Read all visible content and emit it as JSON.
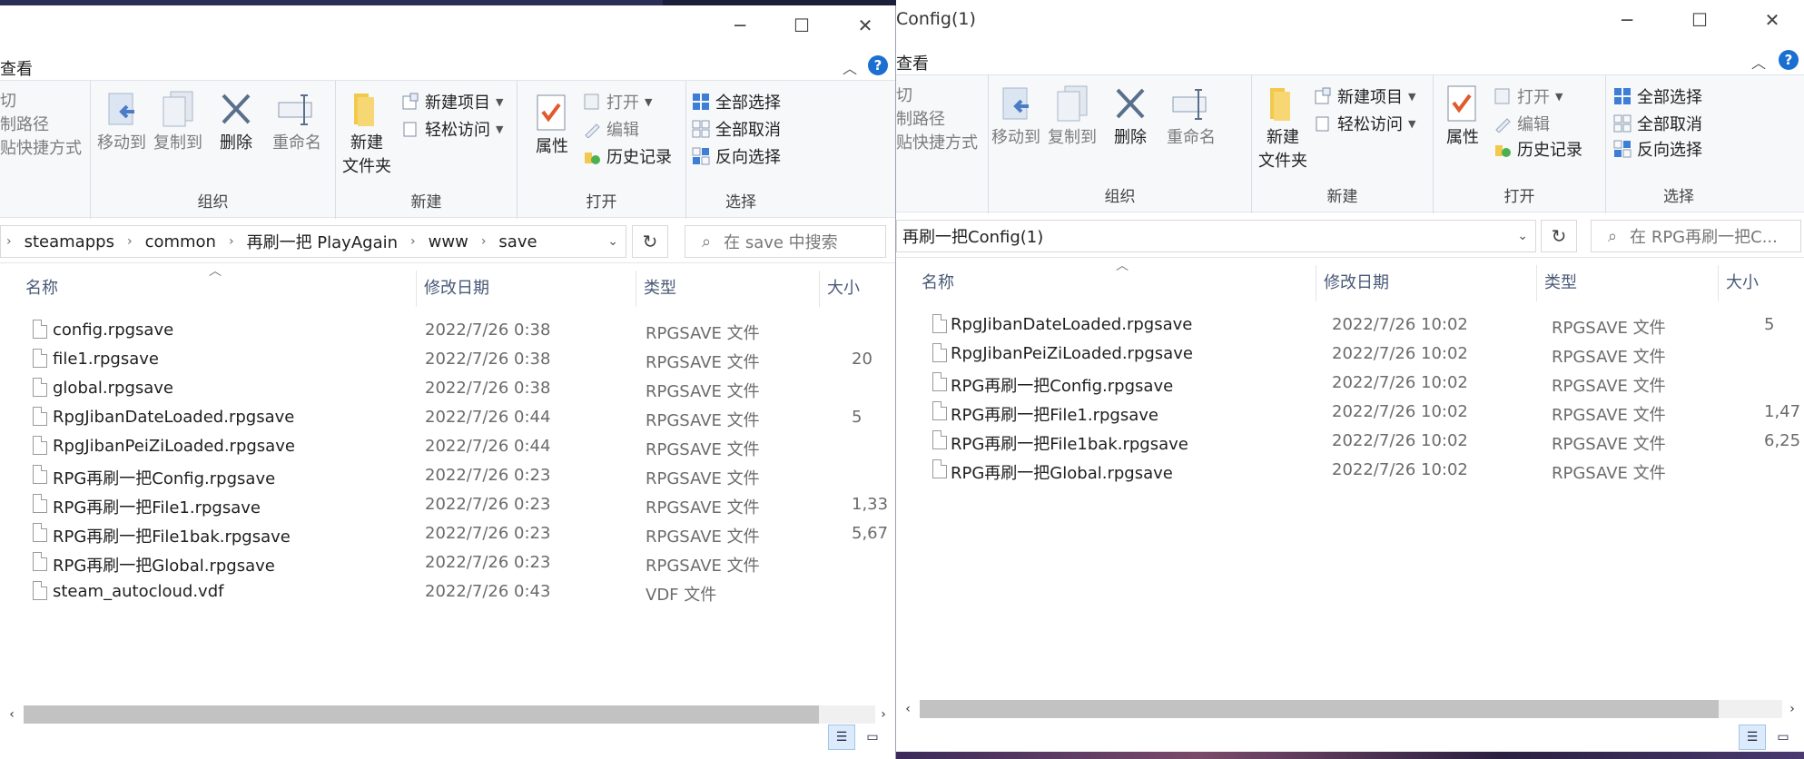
{
  "left": {
    "tab_label": "查看",
    "window_controls": {
      "minimize": "─",
      "maximize": "☐",
      "close": "✕"
    },
    "help_label": "?",
    "ribbon": {
      "clipboard_partial": [
        "切",
        "制路径",
        "贴快捷方式"
      ],
      "organize": {
        "move_to": "移动到",
        "copy_to": "复制到",
        "delete": "删除",
        "rename": "重命名",
        "group": "组织"
      },
      "new": {
        "new_folder_line1": "新建",
        "new_folder_line2": "文件夹",
        "new_item": "新建项目",
        "easy_access": "轻松访问",
        "group": "新建"
      },
      "open": {
        "properties": "属性",
        "open": "打开",
        "edit": "编辑",
        "history": "历史记录",
        "group": "打开"
      },
      "select": {
        "select_all": "全部选择",
        "select_none": "全部取消",
        "invert": "反向选择",
        "group": "选择"
      }
    },
    "address": {
      "crumbs": [
        "steamapps",
        "common",
        "再刷一把 PlayAgain",
        "www",
        "save"
      ]
    },
    "search_placeholder": "在 save 中搜索",
    "columns": {
      "name": "名称",
      "date": "修改日期",
      "type": "类型",
      "size": "大小"
    },
    "files": [
      {
        "name": "config.rpgsave",
        "date": "2022/7/26 0:38",
        "type": "RPGSAVE 文件",
        "size": ""
      },
      {
        "name": "file1.rpgsave",
        "date": "2022/7/26 0:38",
        "type": "RPGSAVE 文件",
        "size": "20"
      },
      {
        "name": "global.rpgsave",
        "date": "2022/7/26 0:38",
        "type": "RPGSAVE 文件",
        "size": ""
      },
      {
        "name": "RpgJibanDateLoaded.rpgsave",
        "date": "2022/7/26 0:44",
        "type": "RPGSAVE 文件",
        "size": "5"
      },
      {
        "name": "RpgJibanPeiZiLoaded.rpgsave",
        "date": "2022/7/26 0:44",
        "type": "RPGSAVE 文件",
        "size": ""
      },
      {
        "name": "RPG再刷一把Config.rpgsave",
        "date": "2022/7/26 0:23",
        "type": "RPGSAVE 文件",
        "size": ""
      },
      {
        "name": "RPG再刷一把File1.rpgsave",
        "date": "2022/7/26 0:23",
        "type": "RPGSAVE 文件",
        "size": "1,33"
      },
      {
        "name": "RPG再刷一把File1bak.rpgsave",
        "date": "2022/7/26 0:23",
        "type": "RPGSAVE 文件",
        "size": "5,67"
      },
      {
        "name": "RPG再刷一把Global.rpgsave",
        "date": "2022/7/26 0:23",
        "type": "RPGSAVE 文件",
        "size": ""
      },
      {
        "name": "steam_autocloud.vdf",
        "date": "2022/7/26 0:43",
        "type": "VDF 文件",
        "size": ""
      }
    ]
  },
  "right": {
    "title": "Config(1)",
    "tab_label": "查看",
    "window_controls": {
      "minimize": "─",
      "maximize": "☐",
      "close": "✕"
    },
    "help_label": "?",
    "ribbon": {
      "clipboard_partial": [
        "切",
        "制路径",
        "贴快捷方式"
      ],
      "organize": {
        "move_to": "移动到",
        "copy_to": "复制到",
        "delete": "删除",
        "rename": "重命名",
        "group": "组织"
      },
      "new": {
        "new_folder_line1": "新建",
        "new_folder_line2": "文件夹",
        "new_item": "新建项目",
        "easy_access": "轻松访问",
        "group": "新建"
      },
      "open": {
        "properties": "属性",
        "open": "打开",
        "edit": "编辑",
        "history": "历史记录",
        "group": "打开"
      },
      "select": {
        "select_all": "全部选择",
        "select_none": "全部取消",
        "invert": "反向选择",
        "group": "选择"
      }
    },
    "address": {
      "crumbs": [
        "再刷一把Config(1)"
      ]
    },
    "search_placeholder": "在 RPG再刷一把C...",
    "columns": {
      "name": "名称",
      "date": "修改日期",
      "type": "类型",
      "size": "大小"
    },
    "files": [
      {
        "name": "RpgJibanDateLoaded.rpgsave",
        "date": "2022/7/26 10:02",
        "type": "RPGSAVE 文件",
        "size": "5"
      },
      {
        "name": "RpgJibanPeiZiLoaded.rpgsave",
        "date": "2022/7/26 10:02",
        "type": "RPGSAVE 文件",
        "size": ""
      },
      {
        "name": "RPG再刷一把Config.rpgsave",
        "date": "2022/7/26 10:02",
        "type": "RPGSAVE 文件",
        "size": ""
      },
      {
        "name": "RPG再刷一把File1.rpgsave",
        "date": "2022/7/26 10:02",
        "type": "RPGSAVE 文件",
        "size": "1,47"
      },
      {
        "name": "RPG再刷一把File1bak.rpgsave",
        "date": "2022/7/26 10:02",
        "type": "RPGSAVE 文件",
        "size": "6,25"
      },
      {
        "name": "RPG再刷一把Global.rpgsave",
        "date": "2022/7/26 10:02",
        "type": "RPGSAVE 文件",
        "size": ""
      }
    ]
  },
  "colors": {
    "accent": "#1a6fd1",
    "header_text": "#4a5a78",
    "muted": "#6b6b6b"
  }
}
